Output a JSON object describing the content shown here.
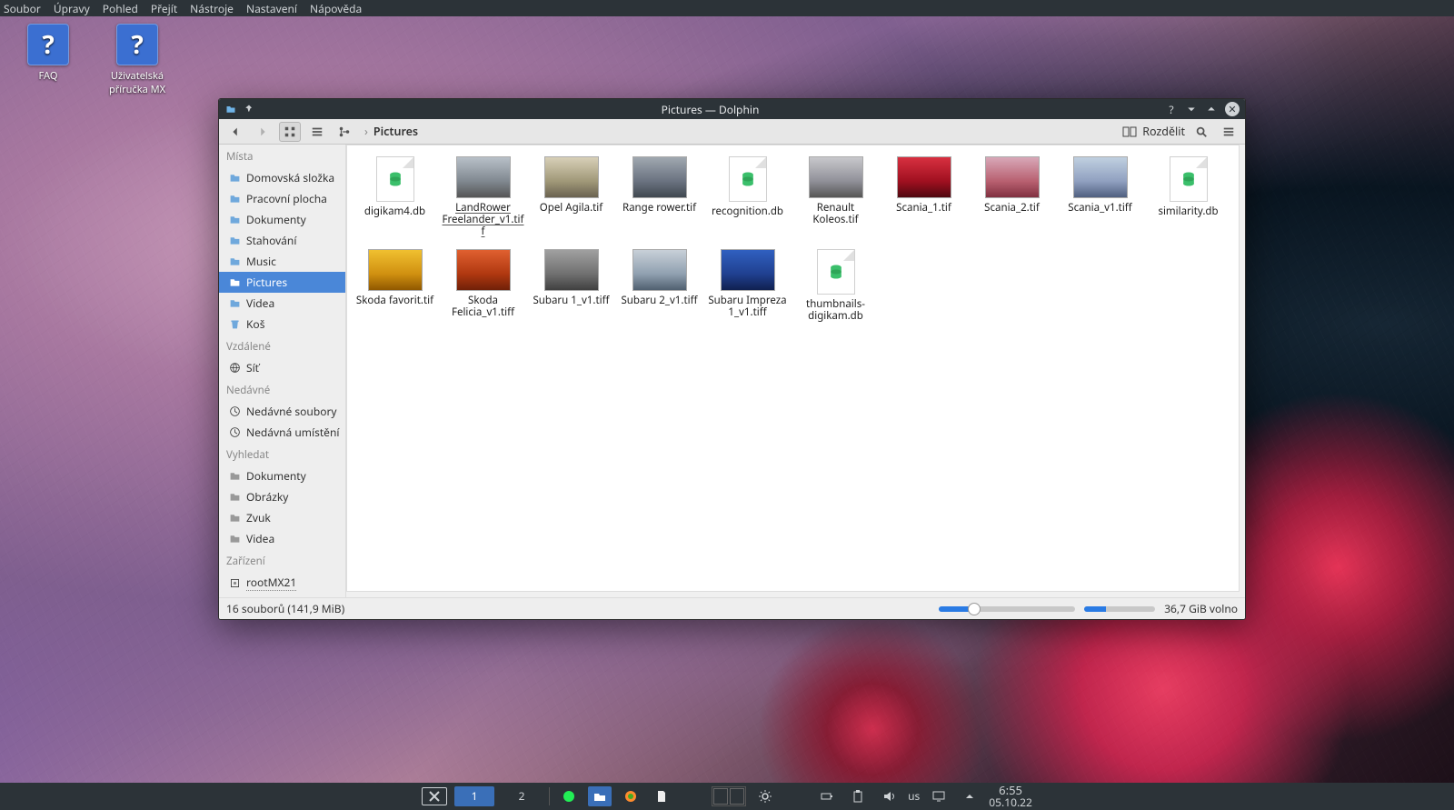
{
  "topbar": {
    "items": [
      "Soubor",
      "Úpravy",
      "Pohled",
      "Přejít",
      "Nástroje",
      "Nastavení",
      "Nápověda"
    ]
  },
  "desktop": {
    "icons": [
      {
        "label": "FAQ"
      },
      {
        "label": "Uživatelská příručka MX"
      }
    ]
  },
  "window": {
    "title": "Pictures — Dolphin",
    "breadcrumb": "Pictures",
    "split_label": "Rozdělit",
    "status_left": "16 souborů (141,9 MiB)",
    "status_right": "36,7 GiB volno"
  },
  "sidebar": {
    "sections": [
      {
        "header": "Místa",
        "items": [
          {
            "label": "Domovská složka",
            "icon": "folder"
          },
          {
            "label": "Pracovní plocha",
            "icon": "folder"
          },
          {
            "label": "Dokumenty",
            "icon": "folder"
          },
          {
            "label": "Stahování",
            "icon": "folder"
          },
          {
            "label": "Music",
            "icon": "folder"
          },
          {
            "label": "Pictures",
            "icon": "folder",
            "selected": true
          },
          {
            "label": "Videa",
            "icon": "folder"
          },
          {
            "label": "Koš",
            "icon": "trash"
          }
        ]
      },
      {
        "header": "Vzdálené",
        "items": [
          {
            "label": "Síť",
            "icon": "network"
          }
        ]
      },
      {
        "header": "Nedávné",
        "items": [
          {
            "label": "Nedávné soubory",
            "icon": "clock"
          },
          {
            "label": "Nedávná umístění",
            "icon": "clock"
          }
        ]
      },
      {
        "header": "Vyhledat",
        "items": [
          {
            "label": "Dokumenty",
            "icon": "folder-gray"
          },
          {
            "label": "Obrázky",
            "icon": "folder-gray"
          },
          {
            "label": "Zvuk",
            "icon": "folder-gray"
          },
          {
            "label": "Videa",
            "icon": "folder-gray"
          }
        ]
      },
      {
        "header": "Zařízení",
        "items": [
          {
            "label": "rootMX21",
            "icon": "disk",
            "underline": true
          }
        ]
      }
    ]
  },
  "files": [
    {
      "name": "digikam4.db",
      "type": "db"
    },
    {
      "name": "LandRower Freelander_v1.tiff",
      "type": "img",
      "cls": "car-a",
      "underline": true
    },
    {
      "name": "Opel Agila.tif",
      "type": "img",
      "cls": "car-b"
    },
    {
      "name": "Range rower.tif",
      "type": "img",
      "cls": "car-c"
    },
    {
      "name": "recognition.db",
      "type": "db"
    },
    {
      "name": "Renault Koleos.tif",
      "type": "img",
      "cls": "car-d"
    },
    {
      "name": "Scania_1.tif",
      "type": "img",
      "cls": "car-e"
    },
    {
      "name": "Scania_2.tif",
      "type": "img",
      "cls": "car-f"
    },
    {
      "name": "Scania_v1.tiff",
      "type": "img",
      "cls": "car-g"
    },
    {
      "name": "similarity.db",
      "type": "db"
    },
    {
      "name": "Skoda favorit.tif",
      "type": "img",
      "cls": "car-h"
    },
    {
      "name": "Skoda Felicia_v1.tiff",
      "type": "img",
      "cls": "car-i"
    },
    {
      "name": "Subaru 1_v1.tiff",
      "type": "img",
      "cls": "car-j"
    },
    {
      "name": "Subaru 2_v1.tiff",
      "type": "img",
      "cls": "car-k"
    },
    {
      "name": "Subaru Impreza 1_v1.tiff",
      "type": "img",
      "cls": "car-l"
    },
    {
      "name": "thumbnails-digikam.db",
      "type": "db"
    }
  ],
  "taskbar": {
    "workspaces": [
      "1",
      "2"
    ],
    "kb_layout": "us",
    "clock": {
      "time": "6:55",
      "date": "05.10.22"
    }
  },
  "colors": {
    "accent": "#3a6fb8"
  }
}
